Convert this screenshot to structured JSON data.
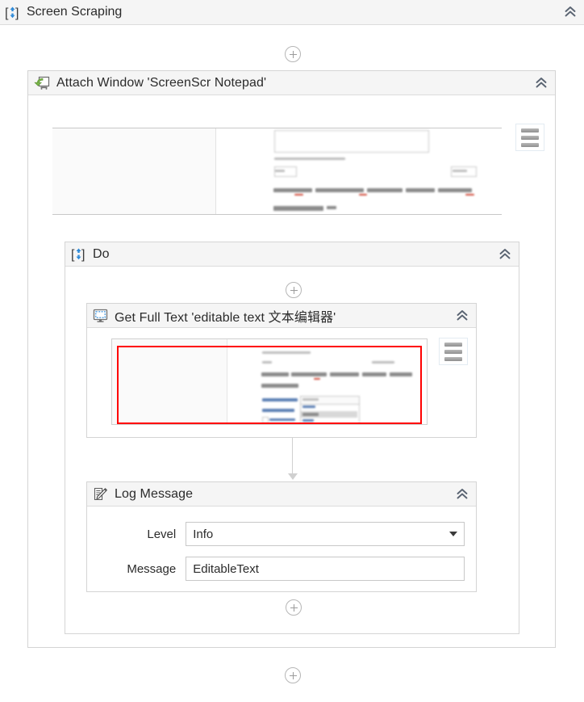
{
  "root": {
    "title": "Screen Scraping",
    "icon": "sequence-icon",
    "collapse_icon": "double-chevron-up-icon"
  },
  "connectors": {
    "add_icon": "plus-circle-icon",
    "arrow_icon": "down-arrow-connector-icon"
  },
  "attach_window": {
    "title": "Attach Window 'ScreenScr Notepad'",
    "icon": "attach-window-icon",
    "collapse_icon": "double-chevron-up-icon",
    "menu_icon": "hamburger-menu-icon",
    "preview_name": "target-window-preview"
  },
  "do_container": {
    "title": "Do",
    "icon": "sequence-icon",
    "collapse_icon": "double-chevron-up-icon"
  },
  "get_full_text": {
    "title": "Get Full Text 'editable text  文本编辑器'",
    "icon": "screen-monitor-icon",
    "collapse_icon": "double-chevron-up-icon",
    "menu_icon": "hamburger-menu-icon",
    "preview_name": "target-element-preview",
    "selection_color": "#ff0000"
  },
  "log_message": {
    "title": "Log Message",
    "icon": "log-message-icon",
    "collapse_icon": "double-chevron-up-icon",
    "fields": {
      "level": {
        "label": "Level",
        "value": "Info",
        "dropdown_icon": "caret-down-icon"
      },
      "message": {
        "label": "Message",
        "value": "EditableText"
      }
    }
  },
  "colors": {
    "header_bg": "#f5f5f5",
    "border": "#d4d4d4",
    "accent_blue": "#2e8ad8",
    "accent_green": "#7ab648",
    "selection_red": "#ff0000",
    "text": "#2b2b2b"
  }
}
